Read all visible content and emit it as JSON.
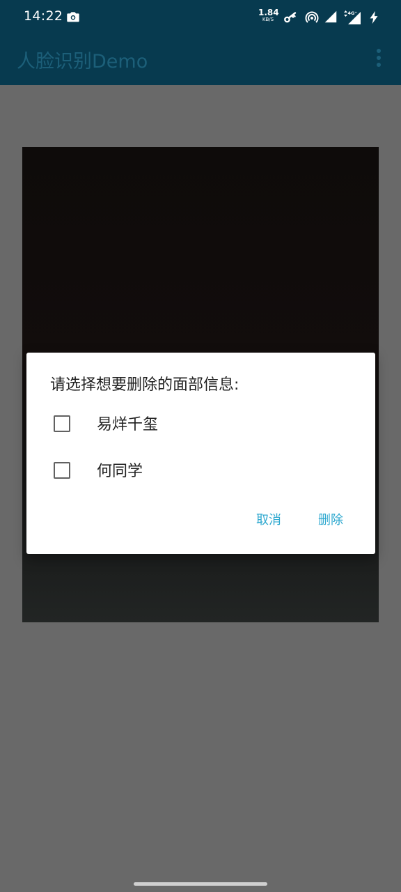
{
  "status_bar": {
    "time": "14:22",
    "net_speed_value": "1.84",
    "net_speed_unit": "KB/S",
    "icons": [
      "camera-icon",
      "key-icon",
      "hotspot-icon",
      "signal-icon",
      "signal-4g-icon",
      "charging-icon"
    ]
  },
  "app_bar": {
    "title": "人脸识别Demo",
    "menu_icon": "more-vert-icon"
  },
  "dialog": {
    "title": "请选择想要删除的面部信息:",
    "options": [
      {
        "label": "易烊千玺",
        "checked": false
      },
      {
        "label": "何同学",
        "checked": false
      }
    ],
    "cancel_label": "取消",
    "delete_label": "删除"
  },
  "colors": {
    "status_bar": "#073a4f",
    "app_bar": "#073a4f",
    "scrim_background": "#696969",
    "dialog_button": "#2ea8cf"
  }
}
